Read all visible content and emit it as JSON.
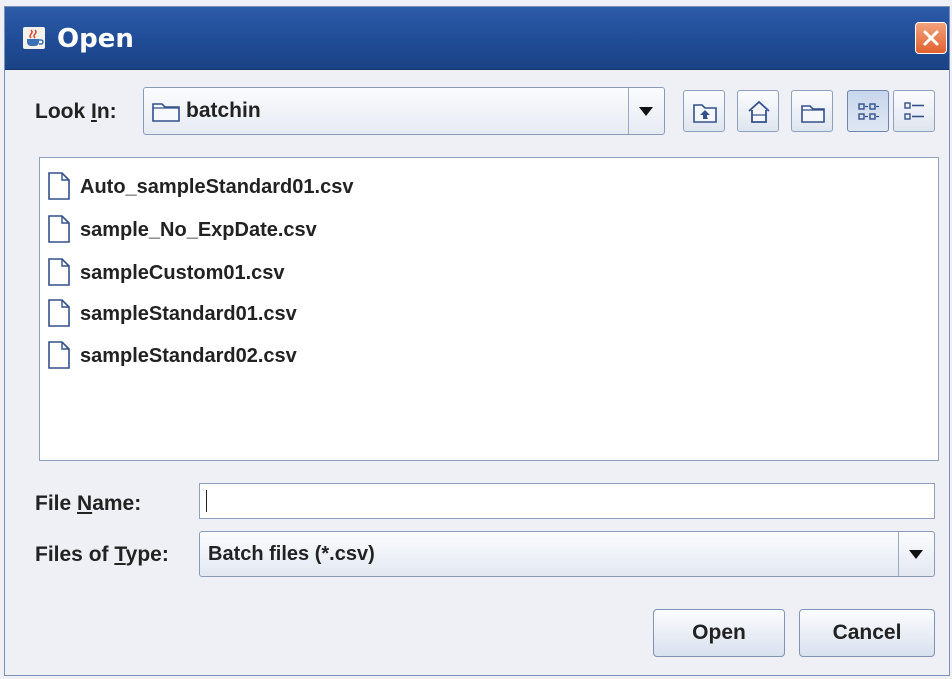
{
  "window": {
    "title": "Open",
    "app_icon": "java-cup-icon",
    "close_icon": "close-icon"
  },
  "lookin": {
    "label_prefix": "Look ",
    "label_mnemonic": "I",
    "label_suffix": "n:",
    "value": "batchin",
    "folder_icon": "folder-icon"
  },
  "toolbar": {
    "buttons": [
      {
        "name": "up-one-level-button",
        "icon": "up-folder-icon"
      },
      {
        "name": "home-button",
        "icon": "home-icon"
      },
      {
        "name": "new-folder-button",
        "icon": "new-folder-icon"
      },
      {
        "name": "list-view-button",
        "icon": "list-view-icon",
        "pressed": true
      },
      {
        "name": "details-view-button",
        "icon": "details-view-icon",
        "pressed": false
      }
    ]
  },
  "files": [
    "Auto_sampleStandard01.csv",
    "sample_No_ExpDate.csv",
    "sampleCustom01.csv",
    "sampleStandard01.csv",
    "sampleStandard02.csv"
  ],
  "filename": {
    "label_prefix": "File ",
    "label_mnemonic": "N",
    "label_suffix": "ame:",
    "value": ""
  },
  "filetype": {
    "label_prefix": "Files of ",
    "label_mnemonic": "T",
    "label_suffix": "ype:",
    "value": "Batch files (*.csv)"
  },
  "buttons": {
    "open": "Open",
    "cancel": "Cancel"
  },
  "colors": {
    "titlebar": "#204c96",
    "close": "#e0612f",
    "background": "#eef0f5"
  }
}
